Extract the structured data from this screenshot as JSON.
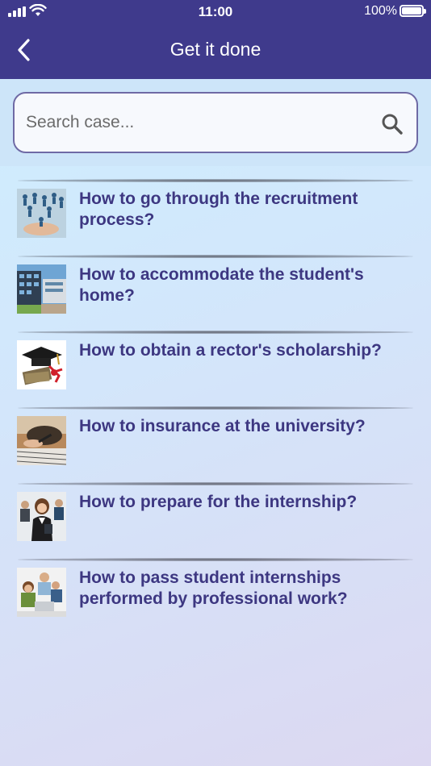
{
  "status": {
    "time": "11:00",
    "battery": "100%"
  },
  "header": {
    "title": "Get it done"
  },
  "search": {
    "placeholder": "Search case..."
  },
  "items": [
    {
      "label": "How to go through the recruitment process?",
      "icon": "recruitment-thumbnail"
    },
    {
      "label": "How to accommodate the student's home?",
      "icon": "dormitory-thumbnail"
    },
    {
      "label": "How to obtain a rector's scholarship?",
      "icon": "scholarship-thumbnail"
    },
    {
      "label": "How to insurance at the university?",
      "icon": "insurance-thumbnail"
    },
    {
      "label": "How to prepare for the internship?",
      "icon": "internship-thumbnail"
    },
    {
      "label": "How to pass student internships performed by professional work?",
      "icon": "professional-work-thumbnail"
    }
  ],
  "colors": {
    "header": "#3f3a8c",
    "itemText": "#3d3781"
  }
}
